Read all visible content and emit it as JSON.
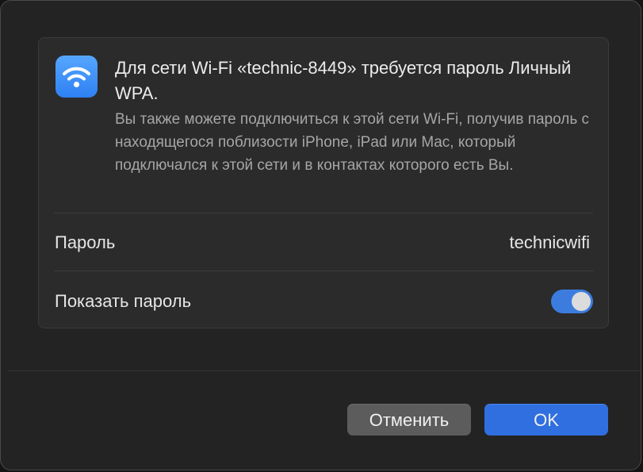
{
  "dialog": {
    "title": "Для сети Wi-Fi «technic-8449» требуется пароль Личный WPA.",
    "subtitle": "Вы также можете подключиться к этой сети Wi-Fi, получив пароль с находящегося поблизости iPhone, iPad или Mac, который подключался к этой сети и в контактах которого есть Вы.",
    "icon": "wifi-icon",
    "accent_color": "#2f80f3"
  },
  "password_row": {
    "label": "Пароль",
    "value": "technicwifi"
  },
  "show_password_row": {
    "label": "Показать пароль",
    "toggle_on": true
  },
  "buttons": {
    "cancel_label": "Отменить",
    "ok_label": "OK"
  }
}
